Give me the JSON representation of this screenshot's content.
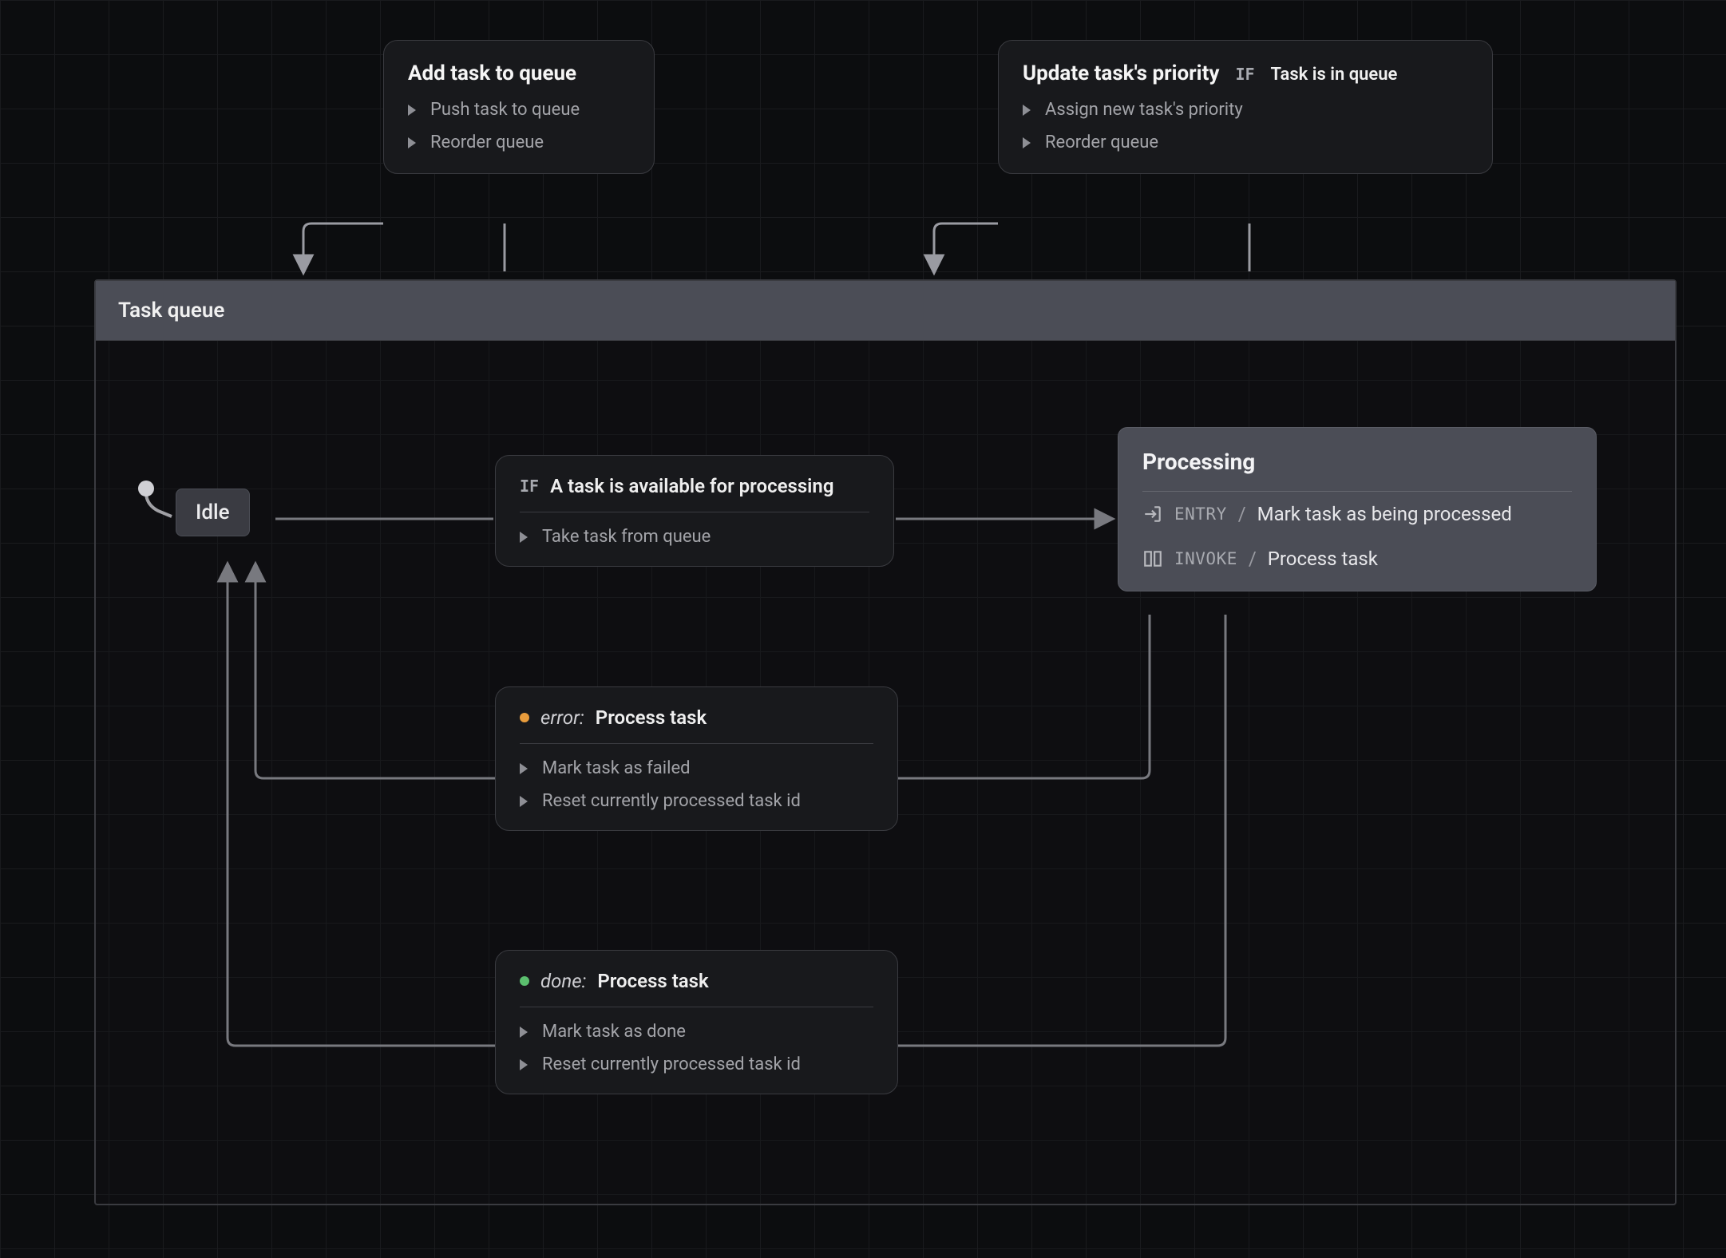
{
  "events": {
    "addTask": {
      "title": "Add task to queue",
      "actions": [
        "Push task to queue",
        "Reorder queue"
      ]
    },
    "updatePriority": {
      "title": "Update task's priority",
      "if": "IF",
      "condition": "Task is in queue",
      "actions": [
        "Assign new task's priority",
        "Reorder queue"
      ]
    }
  },
  "container": {
    "title": "Task queue"
  },
  "states": {
    "idle": "Idle",
    "processing": {
      "title": "Processing",
      "entryKw": "ENTRY",
      "entryAction": "Mark task as being processed",
      "invokeKw": "INVOKE",
      "invokeAction": "Process task"
    }
  },
  "transitions": {
    "available": {
      "ifKw": "IF",
      "condition": "A task is available for processing",
      "action": "Take task from queue"
    },
    "error": {
      "event": "error:",
      "source": "Process task",
      "actions": [
        "Mark task as failed",
        "Reset currently processed task id"
      ]
    },
    "done": {
      "event": "done:",
      "source": "Process task",
      "actions": [
        "Mark task as done",
        "Reset currently processed task id"
      ]
    }
  }
}
